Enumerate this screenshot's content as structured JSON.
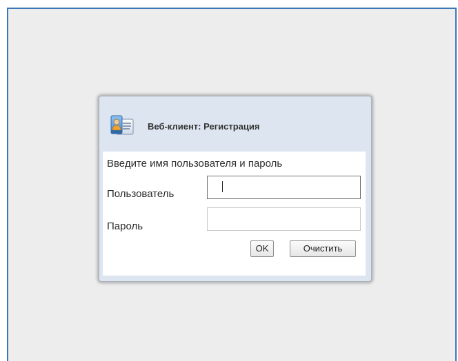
{
  "window": {
    "title": "Веб-клиент: Регистрация",
    "icon": "user-card-icon"
  },
  "form": {
    "prompt": "Введите имя пользователя и пароль",
    "username_label": "Пользователь",
    "username_value": "",
    "password_label": "Пароль",
    "password_value": ""
  },
  "buttons": {
    "ok_label": "OK",
    "clear_label": "Очистить"
  },
  "colors": {
    "frame_border": "#3b76b8",
    "background": "#ededed",
    "dialog_header": "#dde6f0"
  }
}
